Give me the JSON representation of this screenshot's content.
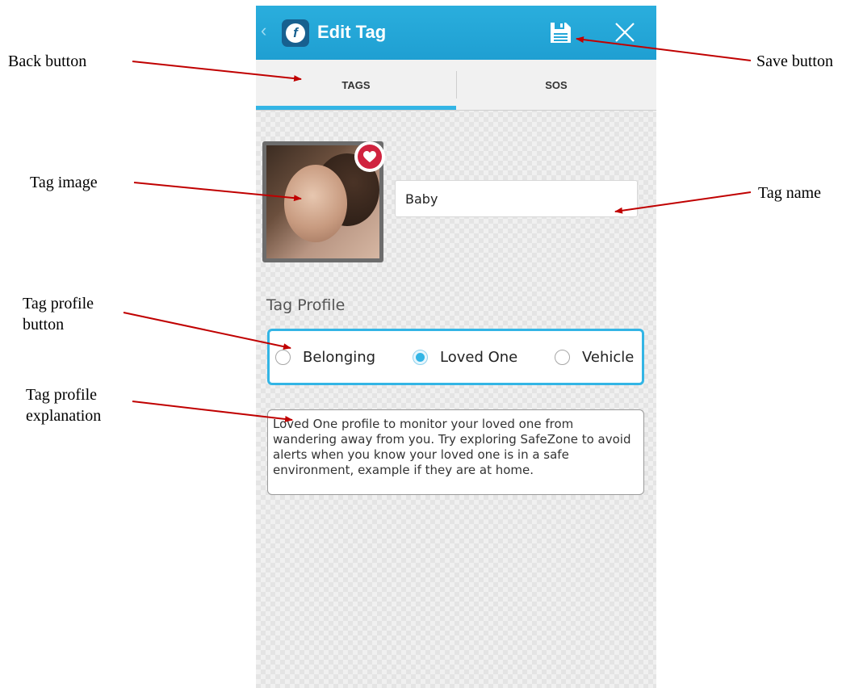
{
  "app": {
    "title": "Edit Tag",
    "icons": {
      "back": "chevron-left-icon",
      "logo": "app-logo-icon",
      "save": "floppy-disk-icon",
      "close": "close-icon"
    },
    "colors": {
      "actionbar": "#1f9fd2",
      "accent": "#33b5e5",
      "favorite": "#d0233f"
    }
  },
  "tabs": [
    {
      "label": "TAGS",
      "selected": true
    },
    {
      "label": "SOS",
      "selected": false
    }
  ],
  "tag": {
    "name_value": "Baby",
    "favorite": true
  },
  "profile": {
    "heading": "Tag Profile",
    "options": [
      {
        "label": "Belonging",
        "selected": false
      },
      {
        "label": "Loved One",
        "selected": true
      },
      {
        "label": "Vehicle",
        "selected": false
      }
    ],
    "explanation": "Loved One profile to monitor your loved one from wandering away from you. Try exploring SafeZone to avoid alerts when you know your loved one is in a safe environment, example if they are at home."
  },
  "annotations": {
    "back_button": "Back button",
    "save_button": "Save button",
    "tag_image": "Tag image",
    "tag_name": "Tag name",
    "tag_profile_button_line1": "Tag profile",
    "tag_profile_button_line2": "button",
    "tag_profile_explanation_line1": "Tag profile",
    "tag_profile_explanation_line2": "explanation",
    "arrow_color": "#c00000"
  }
}
